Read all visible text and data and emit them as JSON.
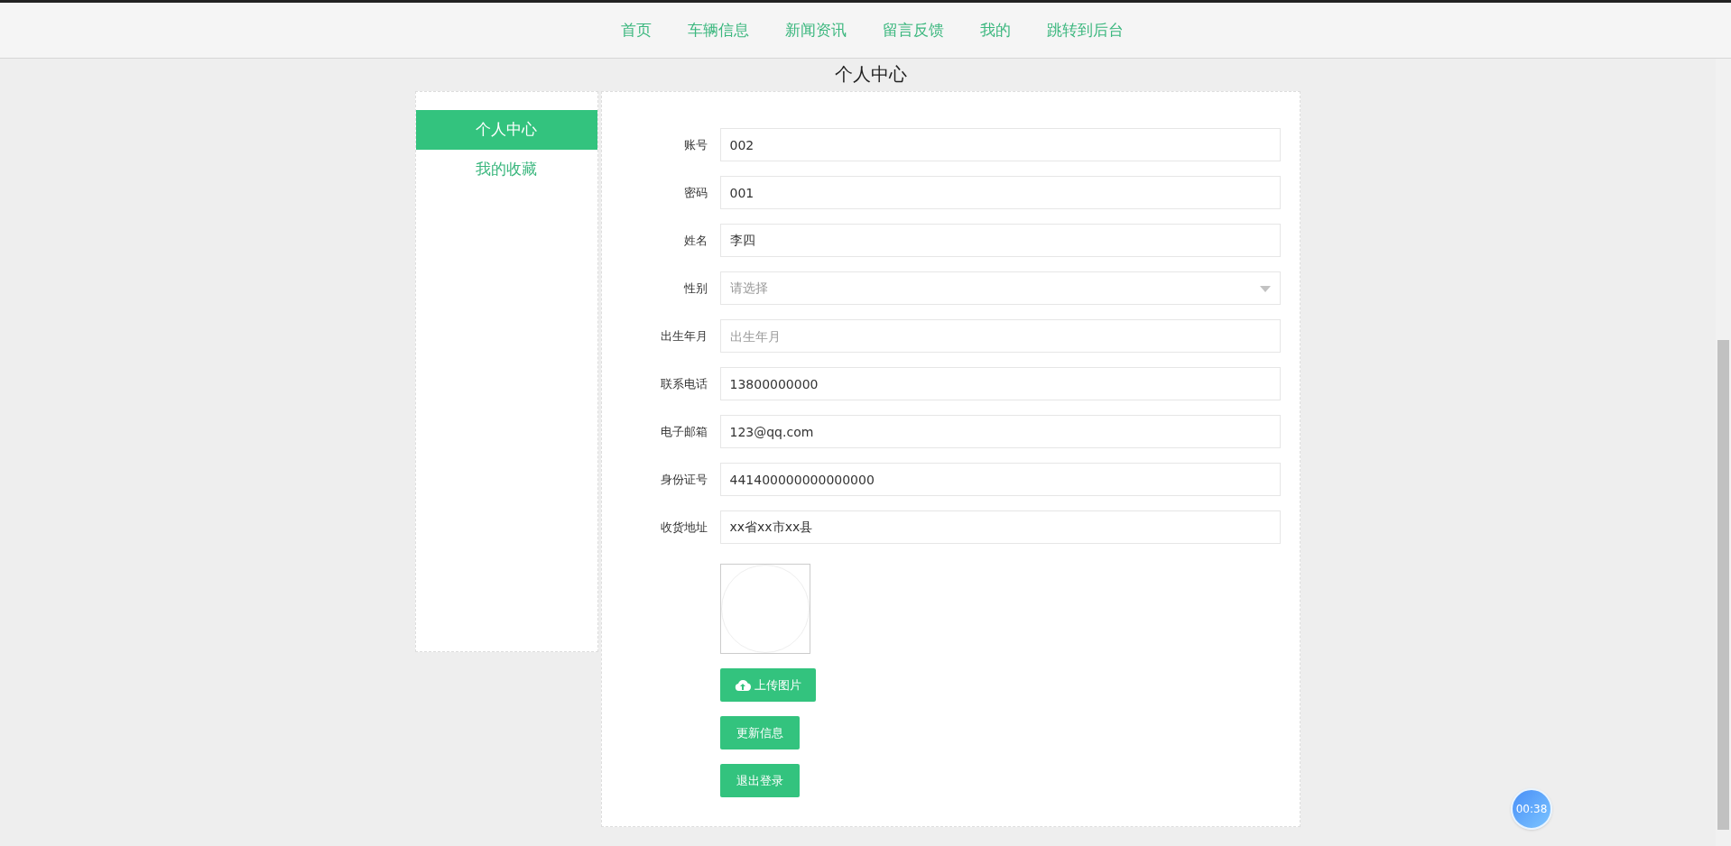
{
  "nav": [
    {
      "label": "首页"
    },
    {
      "label": "车辆信息"
    },
    {
      "label": "新闻资讯"
    },
    {
      "label": "留言反馈"
    },
    {
      "label": "我的"
    },
    {
      "label": "跳转到后台"
    }
  ],
  "page_title": "个人中心",
  "sidebar": [
    {
      "label": "个人中心",
      "selected": true
    },
    {
      "label": "我的收藏",
      "selected": false
    }
  ],
  "form": [
    {
      "kind": "text",
      "label": "账号",
      "value": "002"
    },
    {
      "kind": "text",
      "label": "密码",
      "value": "001"
    },
    {
      "kind": "text",
      "label": "姓名",
      "value": "李四"
    },
    {
      "kind": "select",
      "label": "性别",
      "placeholder": "请选择"
    },
    {
      "kind": "text",
      "label": "出生年月",
      "placeholder": "出生年月"
    },
    {
      "kind": "text",
      "label": "联系电话",
      "value": "13800000000"
    },
    {
      "kind": "text",
      "label": "电子邮箱",
      "value": "123@qq.com"
    },
    {
      "kind": "text",
      "label": "身份证号",
      "value": "441400000000000000"
    },
    {
      "kind": "text",
      "label": "收货地址",
      "value": "xx省xx市xx县"
    }
  ],
  "upload_button": "上传图片",
  "actions": [
    "更新信息",
    "退出登录"
  ],
  "timer": "00:38"
}
